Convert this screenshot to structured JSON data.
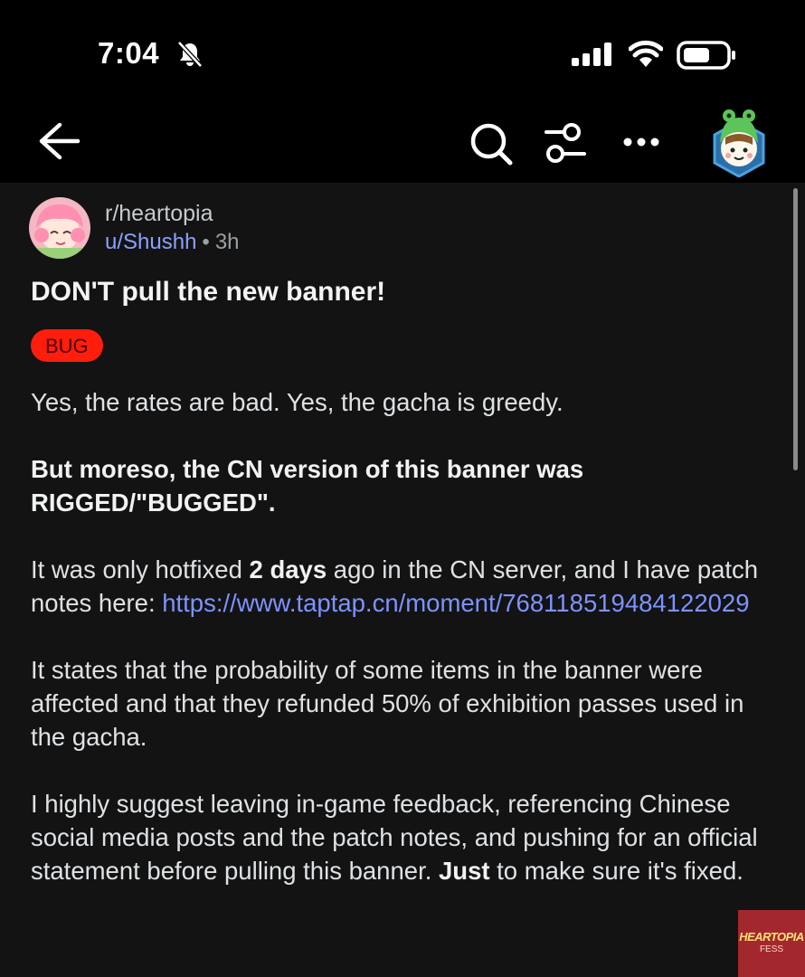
{
  "status": {
    "time": "7:04"
  },
  "post": {
    "subreddit": "r/heartopia",
    "user": "u/Shushh",
    "separator": "•",
    "age": "3h",
    "title": "DON'T pull the new banner!",
    "flair": "BUG",
    "p1": "Yes, the rates are bad. Yes, the gacha is greedy.",
    "p2": "But moreso, the CN version of this banner was RIGGED/\"BUGGED\".",
    "p3_a": "It was only hotfixed ",
    "p3_b": "2 days",
    "p3_c": " ago in the CN server, and I have patch notes here: ",
    "p3_link": "https://www.taptap.cn/moment/768118519484122029",
    "p4": "It states that the probability of some items in the banner were affected and that they refunded 50% of exhibition passes used in the gacha.",
    "p5_a": "I highly suggest leaving in-game feedback, referencing Chinese social media posts and the patch notes, and pushing for an official statement before pulling this banner. ",
    "p5_b": "Just",
    "p5_c": " to make sure it's fixed."
  },
  "watermark": {
    "title": "HEARTOPIA",
    "sub": "FESS"
  },
  "colors": {
    "flair_bg": "#ff1d0d",
    "link": "#7d93ff",
    "user": "#8da0ff",
    "background": "#131313"
  },
  "icons": [
    "bell-slash-icon",
    "signal-icon",
    "wifi-icon",
    "battery-icon",
    "back-arrow-icon",
    "search-icon",
    "filter-icon",
    "more-icon"
  ]
}
